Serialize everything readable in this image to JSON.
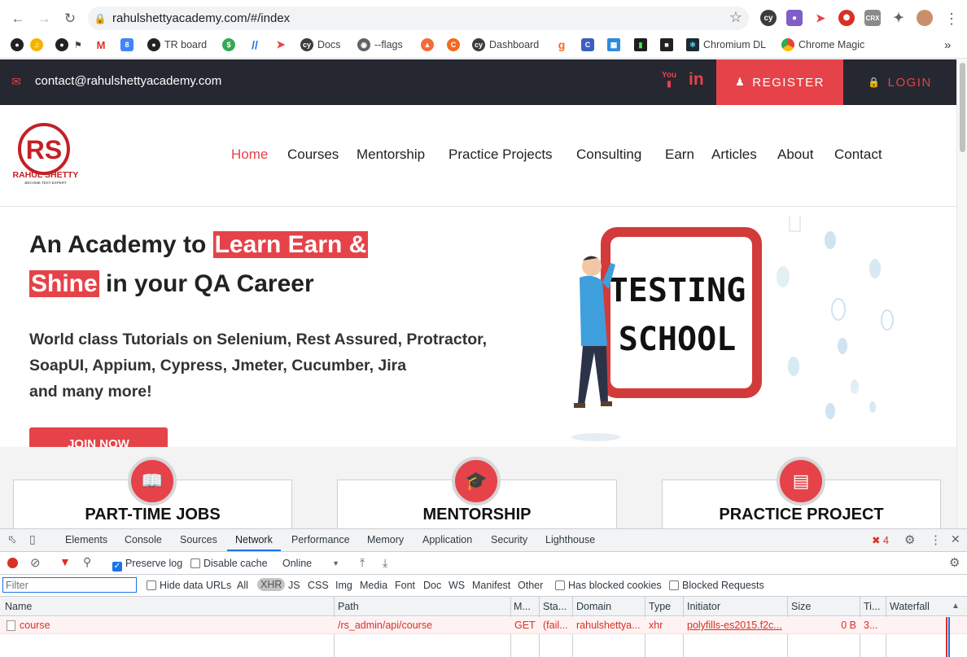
{
  "browser": {
    "url": "rahulshettyacademy.com/#/index",
    "bookmarks": [
      "TR board",
      "Docs",
      "--flags",
      "Dashboard",
      "Chromium DL",
      "Chrome Magic"
    ],
    "bookmark_8": "8",
    "ext_crx": "CRX",
    "more": "»"
  },
  "site": {
    "email": "contact@rahulshettyacademy.com",
    "register_label": "REGISTER",
    "login_label": "LOGIN",
    "youtube_label": "You",
    "linkedin_label": "in",
    "logo_line1": "RAHUL SHETTY",
    "logo_line2": "BECOME TEST EXPERT",
    "nav": [
      "Home",
      "Courses",
      "Mentorship",
      "Practice Projects",
      "Consulting",
      "Earn",
      "Articles",
      "About",
      "Contact"
    ],
    "hero": {
      "line1_plain": "An Academy to ",
      "line1_highlight": "Learn Earn &",
      "line2_highlight": "Shine",
      "line2_plain": " in your QA Career",
      "sub1": "World class Tutorials on Selenium, Rest Assured, Protractor,",
      "sub2": "SoapUI, Appium, Cypress, Jmeter, Cucumber, Jira",
      "sub3": "and many more!",
      "cta": "JOIN NOW",
      "board_line1": "TESTING",
      "board_line2": "SCHOOL"
    },
    "features": [
      "PART-TIME JOBS",
      "MENTORSHIP",
      "PRACTICE PROJECT"
    ]
  },
  "devtools": {
    "tabs": [
      "Elements",
      "Console",
      "Sources",
      "Network",
      "Performance",
      "Memory",
      "Application",
      "Security",
      "Lighthouse"
    ],
    "active_tab": "Network",
    "error_count": "4",
    "preserve_log": "Preserve log",
    "disable_cache": "Disable cache",
    "throttle": "Online",
    "filter_placeholder": "Filter",
    "hide_data_urls": "Hide data URLs",
    "type_filters": [
      "All",
      "XHR",
      "JS",
      "CSS",
      "Img",
      "Media",
      "Font",
      "Doc",
      "WS",
      "Manifest",
      "Other"
    ],
    "active_type": "XHR",
    "has_blocked_cookies": "Has blocked cookies",
    "blocked_requests": "Blocked Requests",
    "columns": [
      "Name",
      "Path",
      "M...",
      "Sta...",
      "Domain",
      "Type",
      "Initiator",
      "Size",
      "Ti...",
      "Waterfall"
    ],
    "rows": [
      {
        "name": "course",
        "path": "/rs_admin/api/course",
        "method": "GET",
        "status": "(fail...",
        "domain": "rahulshettya...",
        "type": "xhr",
        "initiator": "polyfills-es2015.f2c...",
        "size": "0 B",
        "time": "3..."
      }
    ]
  }
}
